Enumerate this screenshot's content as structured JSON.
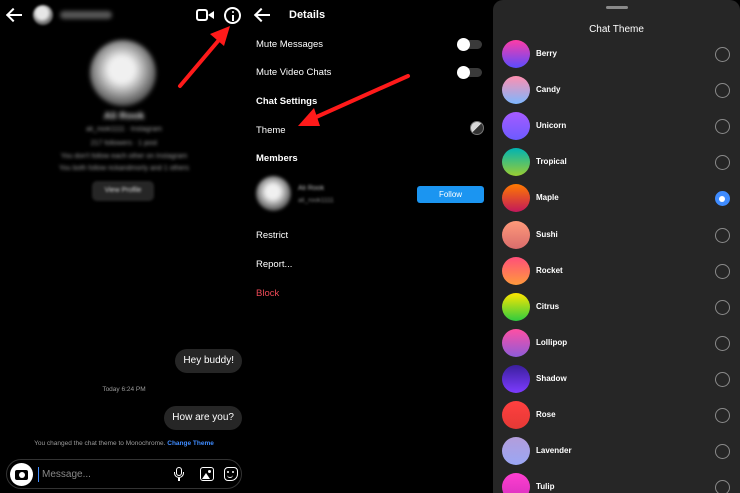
{
  "chat": {
    "profile_name": "Ali Rook",
    "profile_handle": "ali_rook1111 · Instagram",
    "profile_meta": "217 followers · 1 post",
    "profile_note_1": "You don't follow each other on Instagram",
    "profile_note_2": "You both follow rickandmorty and 1 others",
    "view_profile_label": "View Profile",
    "messages": [
      "Hey buddy!",
      "How are you?"
    ],
    "timestamp": "Today 6:24 PM",
    "system_message": "You changed the chat theme to Monochrome.",
    "system_link": "Change Theme",
    "composer_placeholder": "Message..."
  },
  "details": {
    "title": "Details",
    "mute_messages": "Mute Messages",
    "mute_video_chats": "Mute Video Chats",
    "chat_settings": "Chat Settings",
    "theme": "Theme",
    "members": "Members",
    "member_name": "Ali Rook",
    "member_handle": "ali_rook1111",
    "follow": "Follow",
    "restrict": "Restrict",
    "report": "Report...",
    "block": "Block"
  },
  "theme_sheet": {
    "title": "Chat Theme",
    "selected": "Maple",
    "themes": [
      {
        "name": "Berry",
        "colors": [
          "#ff3ca6",
          "#5a4bff"
        ]
      },
      {
        "name": "Candy",
        "colors": [
          "#ff8fb0",
          "#7db7ff"
        ]
      },
      {
        "name": "Unicorn",
        "colors": [
          "#a65bff",
          "#6c5bff"
        ]
      },
      {
        "name": "Tropical",
        "colors": [
          "#00b3b3",
          "#9acd32"
        ]
      },
      {
        "name": "Maple",
        "colors": [
          "#ff7a00",
          "#c2185b"
        ]
      },
      {
        "name": "Sushi",
        "colors": [
          "#ff9a7a",
          "#d96c6c"
        ]
      },
      {
        "name": "Rocket",
        "colors": [
          "#ff4f7a",
          "#ff9a3c"
        ]
      },
      {
        "name": "Citrus",
        "colors": [
          "#ffe600",
          "#2ecc40"
        ]
      },
      {
        "name": "Lollipop",
        "colors": [
          "#ff4fa3",
          "#8e5bd9"
        ]
      },
      {
        "name": "Shadow",
        "colors": [
          "#3b1f9e",
          "#7d3bff"
        ]
      },
      {
        "name": "Rose",
        "colors": [
          "#ff4040",
          "#e53935"
        ]
      },
      {
        "name": "Lavender",
        "colors": [
          "#b39ddb",
          "#9aa7f5"
        ]
      },
      {
        "name": "Tulip",
        "colors": [
          "#ff3fd0",
          "#d62fbe"
        ]
      }
    ]
  },
  "colors": {
    "accent_blue": "#3f8cff",
    "follow_blue": "#1b95f1",
    "block_red": "#ed4956",
    "annotation_arrow_red": "#ff1a1a"
  }
}
